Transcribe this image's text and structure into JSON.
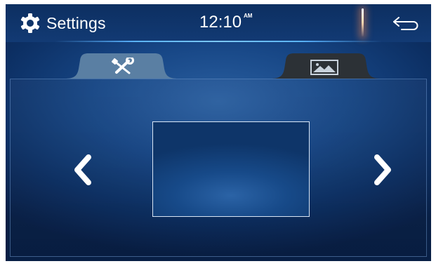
{
  "header": {
    "title": "Settings",
    "time": "12:10",
    "ampm": "AM",
    "icons": {
      "settings": "gear-icon",
      "back": "back-arrow-icon"
    }
  },
  "tabs": [
    {
      "icon": "tools-icon",
      "selected": true
    },
    {
      "icon": "image-icon",
      "selected": false
    }
  ],
  "navigation": {
    "previous_icon": "chevron-left-icon",
    "next_icon": "chevron-right-icon"
  },
  "colors": {
    "background": "#123f7a",
    "tab_selected": "#5a7fa3",
    "tab_unselected": "#2c3136",
    "accent_line": "#5ab4ff"
  }
}
